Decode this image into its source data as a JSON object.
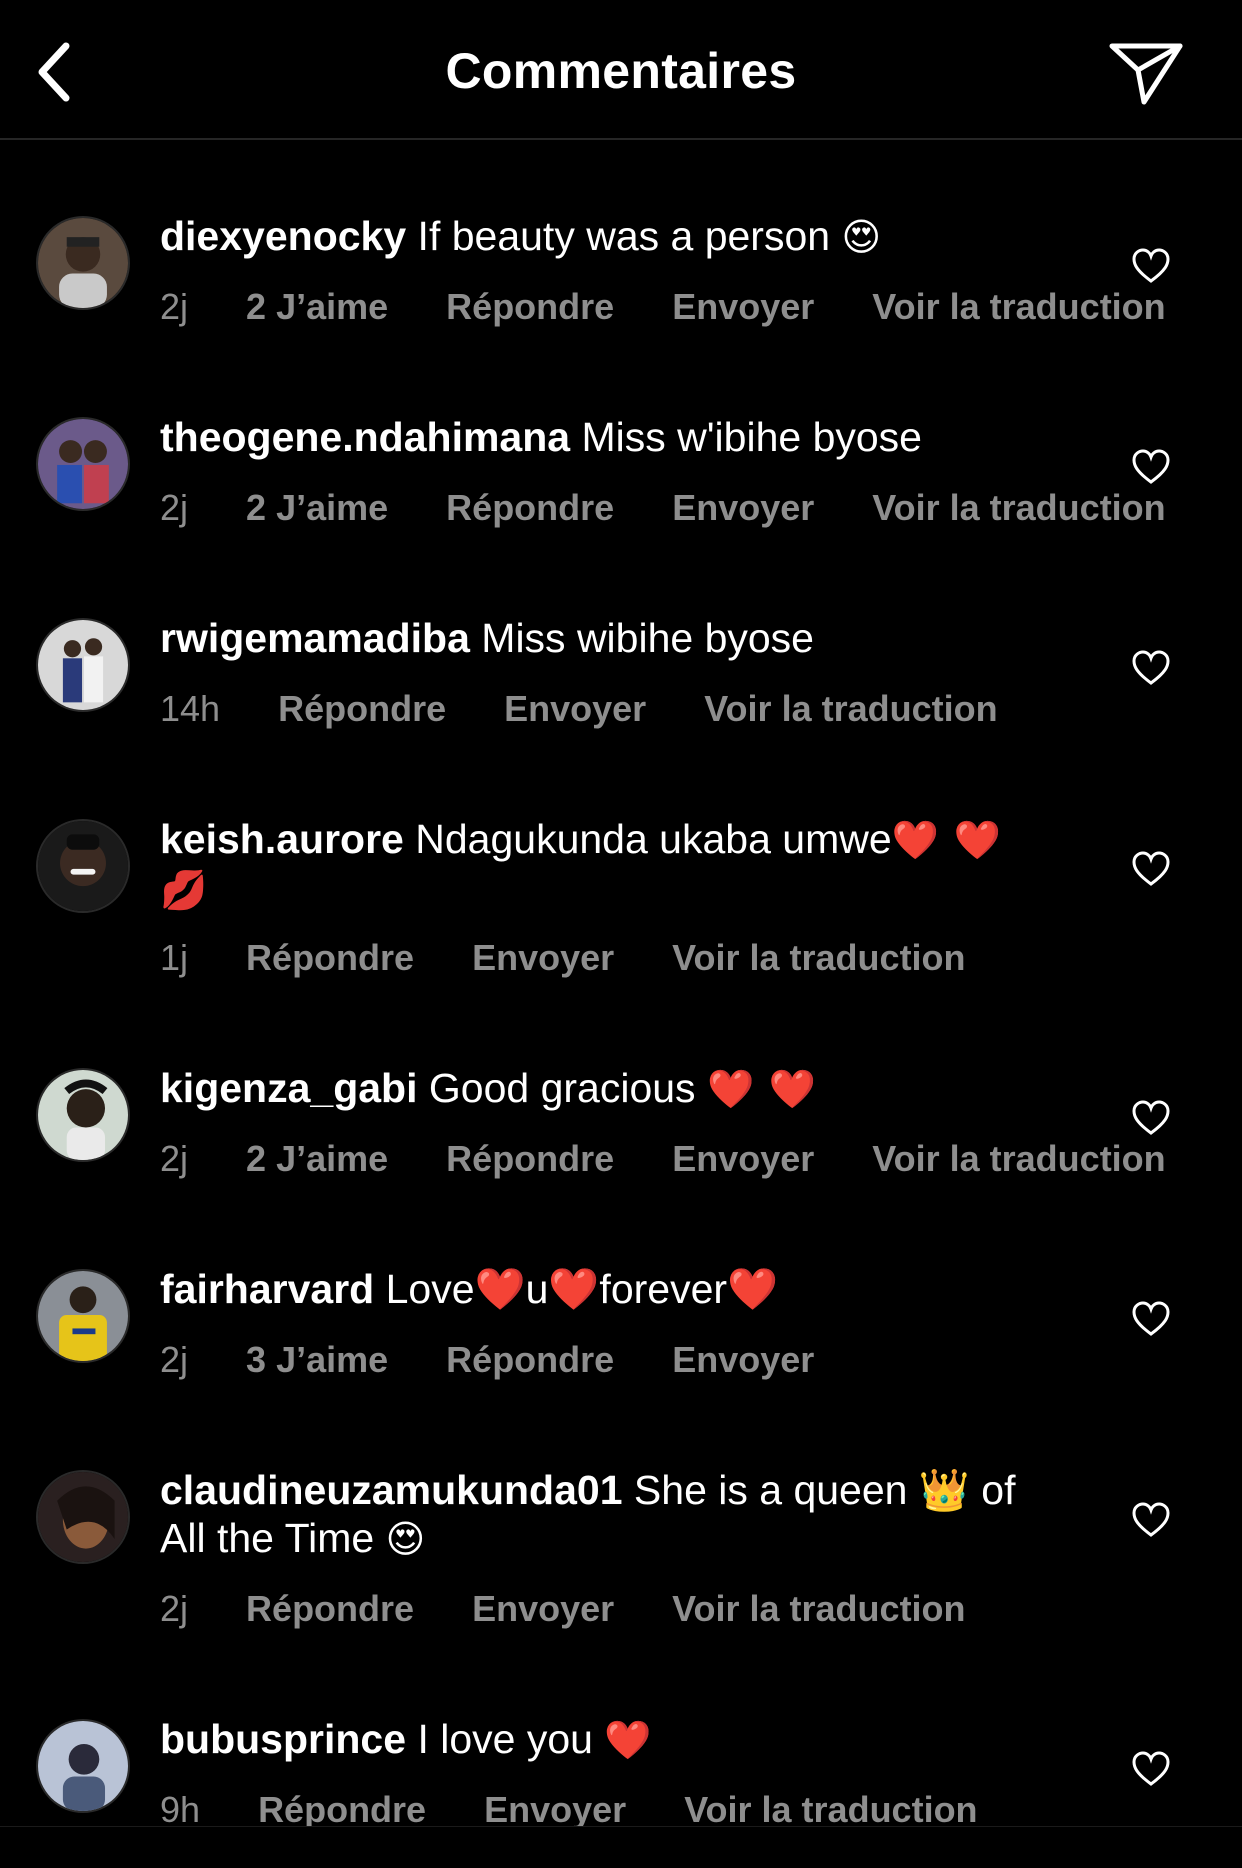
{
  "header": {
    "title": "Commentaires",
    "back_icon": "chevron-left-icon",
    "send_icon": "paper-plane-icon"
  },
  "actions": {
    "reply": "Répondre",
    "send": "Envoyer",
    "translate": "Voir la traduction"
  },
  "comments": [
    {
      "username": "diexyenocky",
      "text": "If beauty was a person",
      "emoji": "😍",
      "time": "2j",
      "likes": "2 J’aime",
      "reply": "Répondre",
      "send": "Envoyer",
      "translate": "Voir la traduction"
    },
    {
      "username": "theogene.ndahimana",
      "text": "Miss w'ibihe byose",
      "emoji": "",
      "time": "2j",
      "likes": "2 J’aime",
      "reply": "Répondre",
      "send": "Envoyer",
      "translate": "Voir la traduction"
    },
    {
      "username": "rwigemamadiba",
      "text": "Miss wibihe byose",
      "emoji": "",
      "time": "14h",
      "reply": "Répondre",
      "send": "Envoyer",
      "translate": "Voir la traduction"
    },
    {
      "username": "keish.aurore",
      "text": "Ndagukunda ukaba umwe",
      "emoji": "❤️ ❤️ 💋",
      "time": "1j",
      "reply": "Répondre",
      "send": "Envoyer",
      "translate": "Voir la traduction"
    },
    {
      "username": "kigenza_gabi",
      "text": "Good gracious",
      "emoji": "❤️ ❤️",
      "time": "2j",
      "likes": "2 J’aime",
      "reply": "Répondre",
      "send": "Envoyer",
      "translate": "Voir la traduction"
    },
    {
      "username": "fairharvard",
      "text": "Love❤️u❤️forever❤️",
      "emoji": "",
      "time": "2j",
      "likes": "3 J’aime",
      "reply": "Répondre",
      "send": "Envoyer"
    },
    {
      "username": "claudineuzamukunda01",
      "text": "She is a queen 👑 of All the Time",
      "emoji": "😍",
      "time": "2j",
      "reply": "Répondre",
      "send": "Envoyer",
      "translate": "Voir la traduction"
    },
    {
      "username": "bubusprince",
      "text": "I love you",
      "emoji": "❤️",
      "time": "9h",
      "reply": "Répondre",
      "send": "Envoyer",
      "translate": "Voir la traduction"
    }
  ],
  "icons": {
    "like": "heart-outline-icon"
  },
  "colors": {
    "background": "#000000",
    "text": "#ffffff",
    "meta": "#8e8e8e"
  }
}
